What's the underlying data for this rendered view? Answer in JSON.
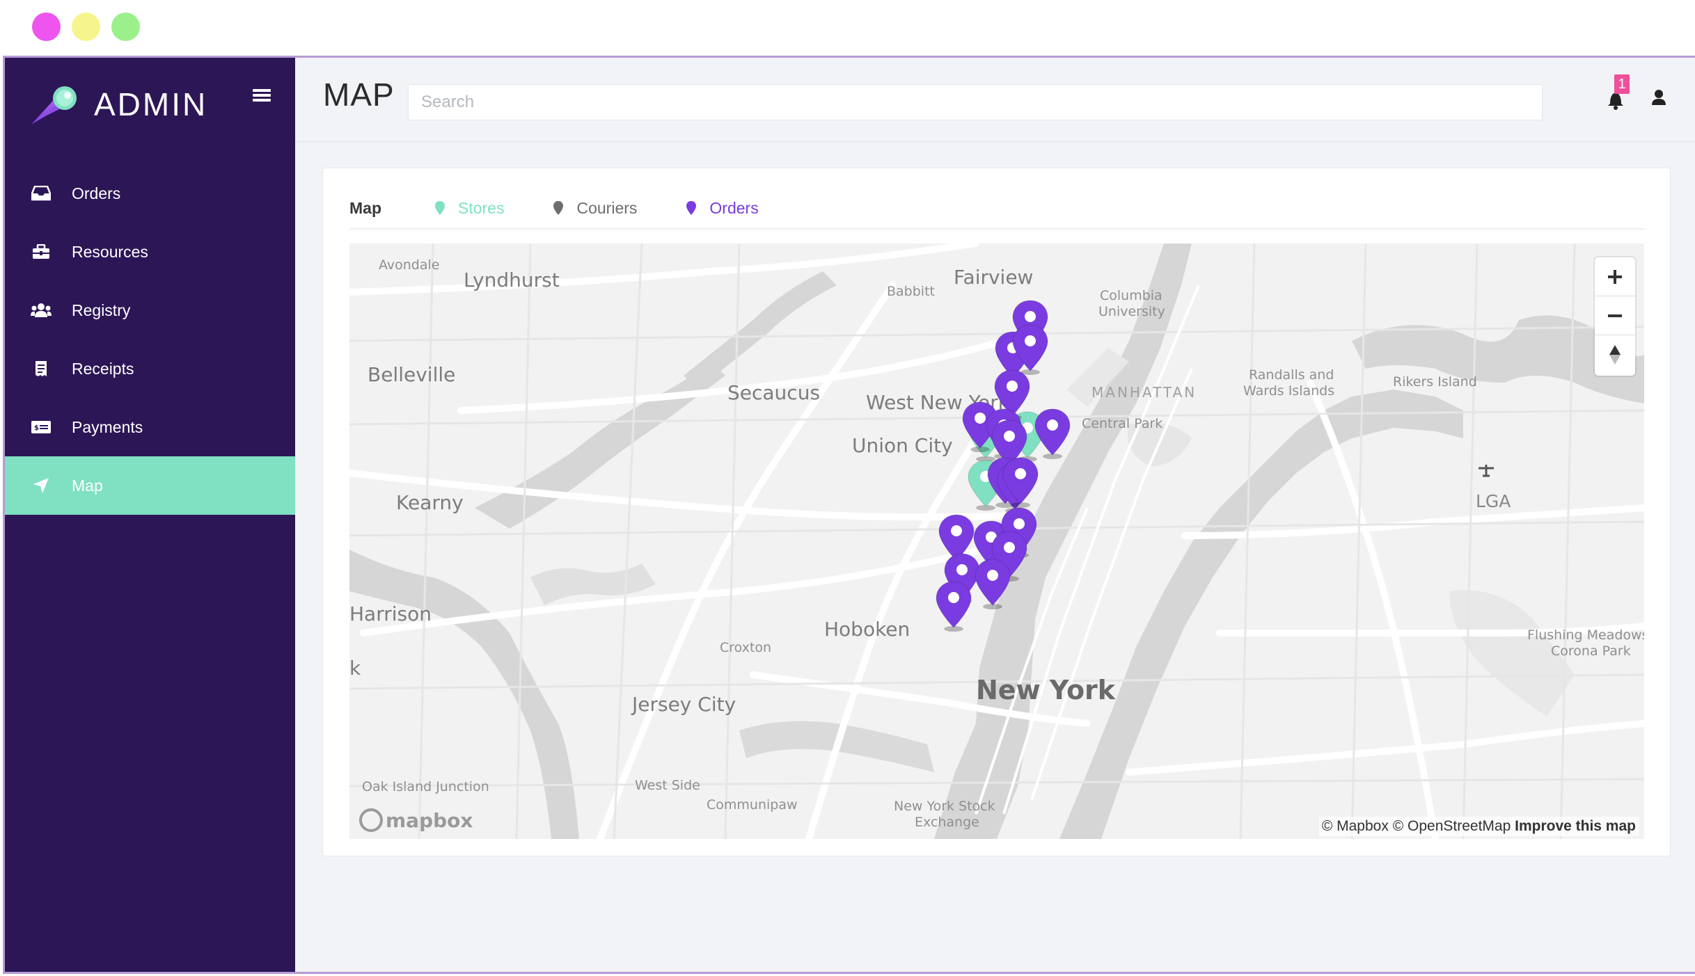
{
  "window": {
    "dots": [
      "#ee55ee",
      "#f6f58c",
      "#9cf08c"
    ]
  },
  "brand": {
    "name": "ADMIN"
  },
  "sidebar": {
    "items": [
      {
        "label": "Orders",
        "icon": "inbox-icon"
      },
      {
        "label": "Resources",
        "icon": "toolbox-icon"
      },
      {
        "label": "Registry",
        "icon": "users-icon"
      },
      {
        "label": "Receipts",
        "icon": "receipt-icon"
      },
      {
        "label": "Payments",
        "icon": "money-bill-icon"
      },
      {
        "label": "Map",
        "icon": "location-arrow-icon",
        "active": true
      }
    ]
  },
  "header": {
    "title": "MAP",
    "search_placeholder": "Search",
    "notification_count": "1"
  },
  "card": {
    "tabs": {
      "map": "Map",
      "stores": "Stores",
      "couriers": "Couriers",
      "orders": "Orders"
    }
  },
  "colors": {
    "sidebar": "#2c1656",
    "active": "#7fe0c2",
    "store": "#7fe0c2",
    "courier": "#6d6d6d",
    "order": "#7a3be0",
    "badge": "#ef4f9b"
  },
  "map": {
    "labels": {
      "avondale": "Avondale",
      "lyndhurst": "Lyndhurst",
      "babbitt": "Babbitt",
      "fairview": "Fairview",
      "columbia": "Columbia",
      "university": "University",
      "belleville": "Belleville",
      "secaucus": "Secaucus",
      "west_new_york": "West New York",
      "manhattan": "MANHATTAN",
      "central_park": "Central Park",
      "randalls": "Randalls and",
      "wards": "Wards Islands",
      "rikers": "Rikers Island",
      "union_city": "Union City",
      "kearny": "Kearny",
      "lga": "LGA",
      "harrison": "Harrison",
      "hoboken": "Hoboken",
      "croxton": "Croxton",
      "flushing1": "Flushing Meadows",
      "flushing2": "Corona Park",
      "k": "k",
      "new_york": "New York",
      "jersey_city": "Jersey City",
      "oak_island": "Oak Island Junction",
      "west_side": "West Side",
      "communipaw": "Communipaw",
      "nyse1": "New York Stock",
      "nyse2": "Exchange"
    },
    "mapbox_logo": "mapbox",
    "attribution": {
      "mapbox": "© Mapbox",
      "osm": "© OpenStreetMap",
      "improve": "Improve this map"
    },
    "zoom_controls": [
      "zoom-in",
      "zoom-out",
      "reset-bearing"
    ]
  }
}
